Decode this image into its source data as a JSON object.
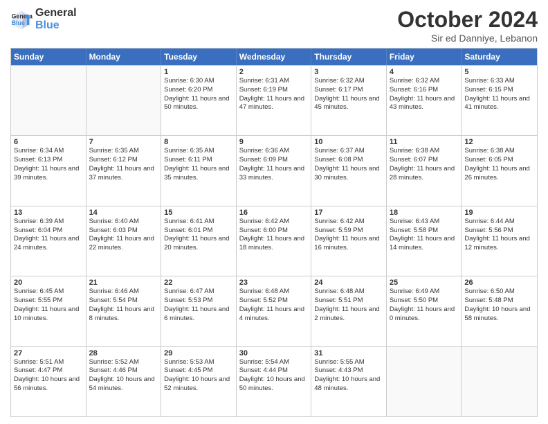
{
  "logo": {
    "line1": "General",
    "line2": "Blue",
    "icon_color": "#4a90d9"
  },
  "header": {
    "month": "October 2024",
    "location": "Sir ed Danniye, Lebanon"
  },
  "days_of_week": [
    "Sunday",
    "Monday",
    "Tuesday",
    "Wednesday",
    "Thursday",
    "Friday",
    "Saturday"
  ],
  "weeks": [
    [
      {
        "day": "",
        "sunrise": "",
        "sunset": "",
        "daylight": ""
      },
      {
        "day": "",
        "sunrise": "",
        "sunset": "",
        "daylight": ""
      },
      {
        "day": "1",
        "sunrise": "Sunrise: 6:30 AM",
        "sunset": "Sunset: 6:20 PM",
        "daylight": "Daylight: 11 hours and 50 minutes."
      },
      {
        "day": "2",
        "sunrise": "Sunrise: 6:31 AM",
        "sunset": "Sunset: 6:19 PM",
        "daylight": "Daylight: 11 hours and 47 minutes."
      },
      {
        "day": "3",
        "sunrise": "Sunrise: 6:32 AM",
        "sunset": "Sunset: 6:17 PM",
        "daylight": "Daylight: 11 hours and 45 minutes."
      },
      {
        "day": "4",
        "sunrise": "Sunrise: 6:32 AM",
        "sunset": "Sunset: 6:16 PM",
        "daylight": "Daylight: 11 hours and 43 minutes."
      },
      {
        "day": "5",
        "sunrise": "Sunrise: 6:33 AM",
        "sunset": "Sunset: 6:15 PM",
        "daylight": "Daylight: 11 hours and 41 minutes."
      }
    ],
    [
      {
        "day": "6",
        "sunrise": "Sunrise: 6:34 AM",
        "sunset": "Sunset: 6:13 PM",
        "daylight": "Daylight: 11 hours and 39 minutes."
      },
      {
        "day": "7",
        "sunrise": "Sunrise: 6:35 AM",
        "sunset": "Sunset: 6:12 PM",
        "daylight": "Daylight: 11 hours and 37 minutes."
      },
      {
        "day": "8",
        "sunrise": "Sunrise: 6:35 AM",
        "sunset": "Sunset: 6:11 PM",
        "daylight": "Daylight: 11 hours and 35 minutes."
      },
      {
        "day": "9",
        "sunrise": "Sunrise: 6:36 AM",
        "sunset": "Sunset: 6:09 PM",
        "daylight": "Daylight: 11 hours and 33 minutes."
      },
      {
        "day": "10",
        "sunrise": "Sunrise: 6:37 AM",
        "sunset": "Sunset: 6:08 PM",
        "daylight": "Daylight: 11 hours and 30 minutes."
      },
      {
        "day": "11",
        "sunrise": "Sunrise: 6:38 AM",
        "sunset": "Sunset: 6:07 PM",
        "daylight": "Daylight: 11 hours and 28 minutes."
      },
      {
        "day": "12",
        "sunrise": "Sunrise: 6:38 AM",
        "sunset": "Sunset: 6:05 PM",
        "daylight": "Daylight: 11 hours and 26 minutes."
      }
    ],
    [
      {
        "day": "13",
        "sunrise": "Sunrise: 6:39 AM",
        "sunset": "Sunset: 6:04 PM",
        "daylight": "Daylight: 11 hours and 24 minutes."
      },
      {
        "day": "14",
        "sunrise": "Sunrise: 6:40 AM",
        "sunset": "Sunset: 6:03 PM",
        "daylight": "Daylight: 11 hours and 22 minutes."
      },
      {
        "day": "15",
        "sunrise": "Sunrise: 6:41 AM",
        "sunset": "Sunset: 6:01 PM",
        "daylight": "Daylight: 11 hours and 20 minutes."
      },
      {
        "day": "16",
        "sunrise": "Sunrise: 6:42 AM",
        "sunset": "Sunset: 6:00 PM",
        "daylight": "Daylight: 11 hours and 18 minutes."
      },
      {
        "day": "17",
        "sunrise": "Sunrise: 6:42 AM",
        "sunset": "Sunset: 5:59 PM",
        "daylight": "Daylight: 11 hours and 16 minutes."
      },
      {
        "day": "18",
        "sunrise": "Sunrise: 6:43 AM",
        "sunset": "Sunset: 5:58 PM",
        "daylight": "Daylight: 11 hours and 14 minutes."
      },
      {
        "day": "19",
        "sunrise": "Sunrise: 6:44 AM",
        "sunset": "Sunset: 5:56 PM",
        "daylight": "Daylight: 11 hours and 12 minutes."
      }
    ],
    [
      {
        "day": "20",
        "sunrise": "Sunrise: 6:45 AM",
        "sunset": "Sunset: 5:55 PM",
        "daylight": "Daylight: 11 hours and 10 minutes."
      },
      {
        "day": "21",
        "sunrise": "Sunrise: 6:46 AM",
        "sunset": "Sunset: 5:54 PM",
        "daylight": "Daylight: 11 hours and 8 minutes."
      },
      {
        "day": "22",
        "sunrise": "Sunrise: 6:47 AM",
        "sunset": "Sunset: 5:53 PM",
        "daylight": "Daylight: 11 hours and 6 minutes."
      },
      {
        "day": "23",
        "sunrise": "Sunrise: 6:48 AM",
        "sunset": "Sunset: 5:52 PM",
        "daylight": "Daylight: 11 hours and 4 minutes."
      },
      {
        "day": "24",
        "sunrise": "Sunrise: 6:48 AM",
        "sunset": "Sunset: 5:51 PM",
        "daylight": "Daylight: 11 hours and 2 minutes."
      },
      {
        "day": "25",
        "sunrise": "Sunrise: 6:49 AM",
        "sunset": "Sunset: 5:50 PM",
        "daylight": "Daylight: 11 hours and 0 minutes."
      },
      {
        "day": "26",
        "sunrise": "Sunrise: 6:50 AM",
        "sunset": "Sunset: 5:48 PM",
        "daylight": "Daylight: 10 hours and 58 minutes."
      }
    ],
    [
      {
        "day": "27",
        "sunrise": "Sunrise: 5:51 AM",
        "sunset": "Sunset: 4:47 PM",
        "daylight": "Daylight: 10 hours and 56 minutes."
      },
      {
        "day": "28",
        "sunrise": "Sunrise: 5:52 AM",
        "sunset": "Sunset: 4:46 PM",
        "daylight": "Daylight: 10 hours and 54 minutes."
      },
      {
        "day": "29",
        "sunrise": "Sunrise: 5:53 AM",
        "sunset": "Sunset: 4:45 PM",
        "daylight": "Daylight: 10 hours and 52 minutes."
      },
      {
        "day": "30",
        "sunrise": "Sunrise: 5:54 AM",
        "sunset": "Sunset: 4:44 PM",
        "daylight": "Daylight: 10 hours and 50 minutes."
      },
      {
        "day": "31",
        "sunrise": "Sunrise: 5:55 AM",
        "sunset": "Sunset: 4:43 PM",
        "daylight": "Daylight: 10 hours and 48 minutes."
      },
      {
        "day": "",
        "sunrise": "",
        "sunset": "",
        "daylight": ""
      },
      {
        "day": "",
        "sunrise": "",
        "sunset": "",
        "daylight": ""
      }
    ]
  ]
}
